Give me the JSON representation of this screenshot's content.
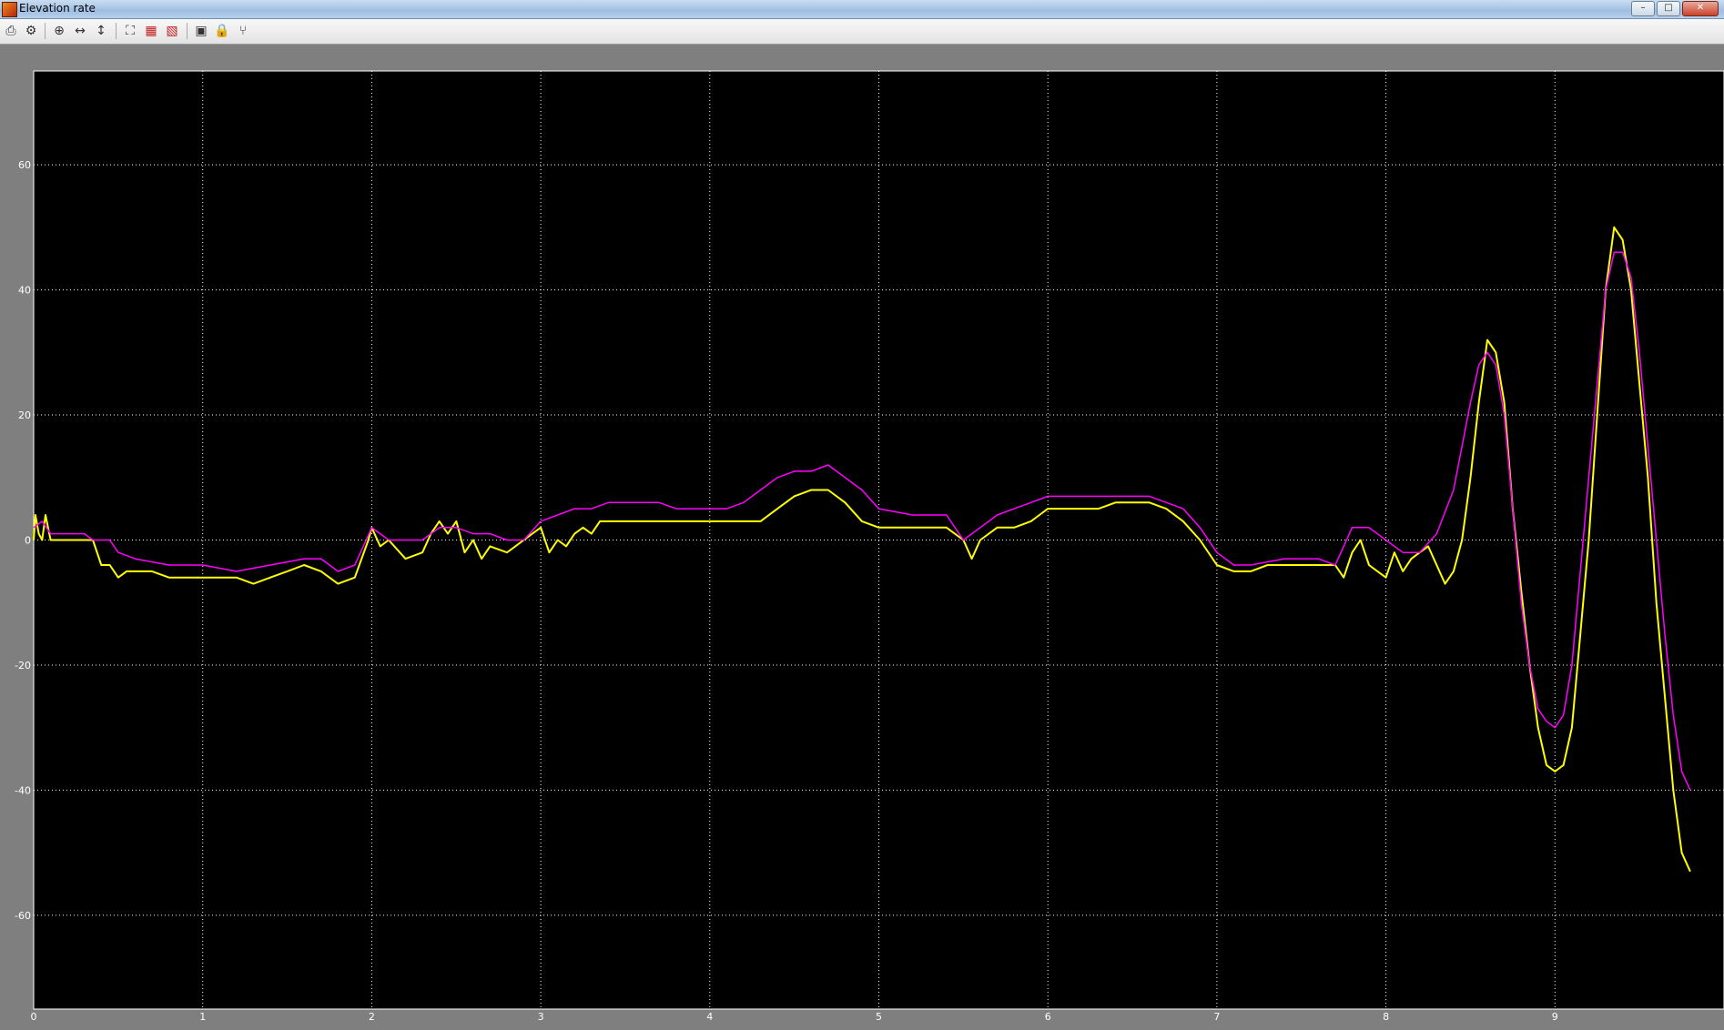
{
  "window": {
    "title": "Elevation rate",
    "controls": [
      "–",
      "□",
      "✕"
    ]
  },
  "toolbar": {
    "items": [
      {
        "name": "print-icon",
        "glyph": "⎙"
      },
      {
        "name": "parameters-icon",
        "glyph": "⚙"
      },
      {
        "name": "zoom-in-icon",
        "glyph": "⊕"
      },
      {
        "name": "zoom-x-icon",
        "glyph": "↔"
      },
      {
        "name": "zoom-y-icon",
        "glyph": "↕"
      },
      {
        "name": "autoscale-icon",
        "glyph": "⛶"
      },
      {
        "name": "save-axes-icon",
        "glyph": "▦"
      },
      {
        "name": "restore-axes-icon",
        "glyph": "▧"
      },
      {
        "name": "float-icon",
        "glyph": "▣"
      },
      {
        "name": "lock-axes-icon",
        "glyph": "🔒"
      },
      {
        "name": "signal-selection-icon",
        "glyph": "⑂"
      }
    ]
  },
  "chart_data": {
    "type": "line",
    "title": "",
    "xlabel": "",
    "ylabel": "",
    "xlim": [
      0,
      10
    ],
    "ylim": [
      -75,
      75
    ],
    "xticks": [
      0,
      1,
      2,
      3,
      4,
      5,
      6,
      7,
      8,
      9
    ],
    "yticks": [
      -60,
      -40,
      -20,
      0,
      20,
      40,
      60
    ],
    "grid": true,
    "background": "#000000",
    "axes_color": "#ffffff",
    "series": [
      {
        "color": "#ffff00",
        "x": [
          0,
          0.01,
          0.03,
          0.05,
          0.07,
          0.1,
          0.3,
          0.35,
          0.4,
          0.45,
          0.5,
          0.55,
          0.6,
          0.7,
          0.8,
          0.9,
          1.0,
          1.1,
          1.2,
          1.3,
          1.4,
          1.5,
          1.6,
          1.7,
          1.8,
          1.9,
          1.98,
          2.0,
          2.05,
          2.1,
          2.2,
          2.3,
          2.35,
          2.4,
          2.45,
          2.5,
          2.55,
          2.6,
          2.65,
          2.7,
          2.8,
          2.9,
          2.95,
          3.0,
          3.05,
          3.1,
          3.15,
          3.2,
          3.25,
          3.3,
          3.35,
          3.4,
          3.5,
          3.6,
          3.7,
          3.8,
          3.9,
          4.0,
          4.1,
          4.2,
          4.3,
          4.4,
          4.5,
          4.6,
          4.7,
          4.8,
          4.9,
          5.0,
          5.1,
          5.2,
          5.3,
          5.4,
          5.5,
          5.55,
          5.6,
          5.7,
          5.8,
          5.9,
          6.0,
          6.1,
          6.2,
          6.3,
          6.4,
          6.5,
          6.6,
          6.7,
          6.8,
          6.9,
          7.0,
          7.1,
          7.2,
          7.3,
          7.4,
          7.5,
          7.6,
          7.7,
          7.75,
          7.8,
          7.85,
          7.9,
          7.95,
          8.0,
          8.05,
          8.1,
          8.15,
          8.2,
          8.25,
          8.3,
          8.35,
          8.4,
          8.45,
          8.5,
          8.55,
          8.6,
          8.65,
          8.7,
          8.75,
          8.8,
          8.85,
          8.9,
          8.95,
          9.0,
          9.05,
          9.1,
          9.15,
          9.2,
          9.25,
          9.3,
          9.35,
          9.4,
          9.45,
          9.5,
          9.55,
          9.6,
          9.65,
          9.7,
          9.75,
          9.8
        ],
        "y": [
          0,
          4,
          1,
          0,
          4,
          0,
          0,
          0,
          -4,
          -4,
          -6,
          -5,
          -5,
          -5,
          -6,
          -6,
          -6,
          -6,
          -6,
          -7,
          -6,
          -5,
          -4,
          -5,
          -7,
          -6,
          0,
          2,
          -1,
          0,
          -3,
          -2,
          1,
          3,
          1,
          3,
          -2,
          0,
          -3,
          -1,
          -2,
          0,
          1,
          2,
          -2,
          0,
          -1,
          1,
          2,
          1,
          3,
          3,
          3,
          3,
          3,
          3,
          3,
          3,
          3,
          3,
          3,
          5,
          7,
          8,
          8,
          6,
          3,
          2,
          2,
          2,
          2,
          2,
          0,
          -3,
          0,
          2,
          2,
          3,
          5,
          5,
          5,
          5,
          6,
          6,
          6,
          5,
          3,
          0,
          -4,
          -5,
          -5,
          -4,
          -4,
          -4,
          -4,
          -4,
          -6,
          -2,
          0,
          -4,
          -5,
          -6,
          -2,
          -5,
          -3,
          -2,
          -1,
          -4,
          -7,
          -5,
          0,
          10,
          22,
          32,
          30,
          22,
          5,
          -8,
          -20,
          -30,
          -36,
          -37,
          -36,
          -30,
          -15,
          0,
          20,
          40,
          50,
          48,
          40,
          25,
          10,
          -10,
          -25,
          -40,
          -50,
          -53
        ]
      },
      {
        "color": "#ff00ff",
        "x": [
          0,
          0.05,
          0.1,
          0.3,
          0.35,
          0.45,
          0.5,
          0.6,
          0.8,
          1.0,
          1.2,
          1.4,
          1.6,
          1.7,
          1.8,
          1.9,
          2.0,
          2.05,
          2.1,
          2.2,
          2.3,
          2.4,
          2.5,
          2.6,
          2.7,
          2.8,
          2.9,
          3.0,
          3.1,
          3.2,
          3.3,
          3.4,
          3.5,
          3.6,
          3.7,
          3.8,
          3.9,
          4.0,
          4.1,
          4.2,
          4.3,
          4.4,
          4.5,
          4.6,
          4.7,
          4.8,
          4.9,
          5.0,
          5.2,
          5.4,
          5.5,
          5.6,
          5.7,
          5.8,
          5.9,
          6.0,
          6.2,
          6.4,
          6.6,
          6.8,
          6.9,
          7.0,
          7.1,
          7.2,
          7.4,
          7.5,
          7.6,
          7.7,
          7.8,
          7.85,
          7.9,
          8.0,
          8.1,
          8.2,
          8.3,
          8.4,
          8.45,
          8.5,
          8.55,
          8.6,
          8.65,
          8.7,
          8.75,
          8.8,
          8.85,
          8.9,
          8.95,
          9.0,
          9.05,
          9.1,
          9.15,
          9.2,
          9.25,
          9.3,
          9.35,
          9.4,
          9.45,
          9.5,
          9.55,
          9.6,
          9.65,
          9.7,
          9.75,
          9.8
        ],
        "y": [
          2,
          3,
          1,
          1,
          0,
          0,
          -2,
          -3,
          -4,
          -4,
          -5,
          -4,
          -3,
          -3,
          -5,
          -4,
          2,
          1,
          0,
          0,
          0,
          2,
          2,
          1,
          1,
          0,
          0,
          3,
          4,
          5,
          5,
          6,
          6,
          6,
          6,
          5,
          5,
          5,
          5,
          6,
          8,
          10,
          11,
          11,
          12,
          10,
          8,
          5,
          4,
          4,
          0,
          2,
          4,
          5,
          6,
          7,
          7,
          7,
          7,
          5,
          2,
          -2,
          -4,
          -4,
          -3,
          -3,
          -3,
          -4,
          2,
          2,
          2,
          0,
          -2,
          -2,
          1,
          8,
          15,
          22,
          28,
          30,
          28,
          20,
          5,
          -10,
          -20,
          -27,
          -29,
          -30,
          -28,
          -20,
          -5,
          10,
          25,
          40,
          46,
          46,
          42,
          30,
          15,
          0,
          -15,
          -28,
          -37,
          -40
        ]
      }
    ]
  }
}
